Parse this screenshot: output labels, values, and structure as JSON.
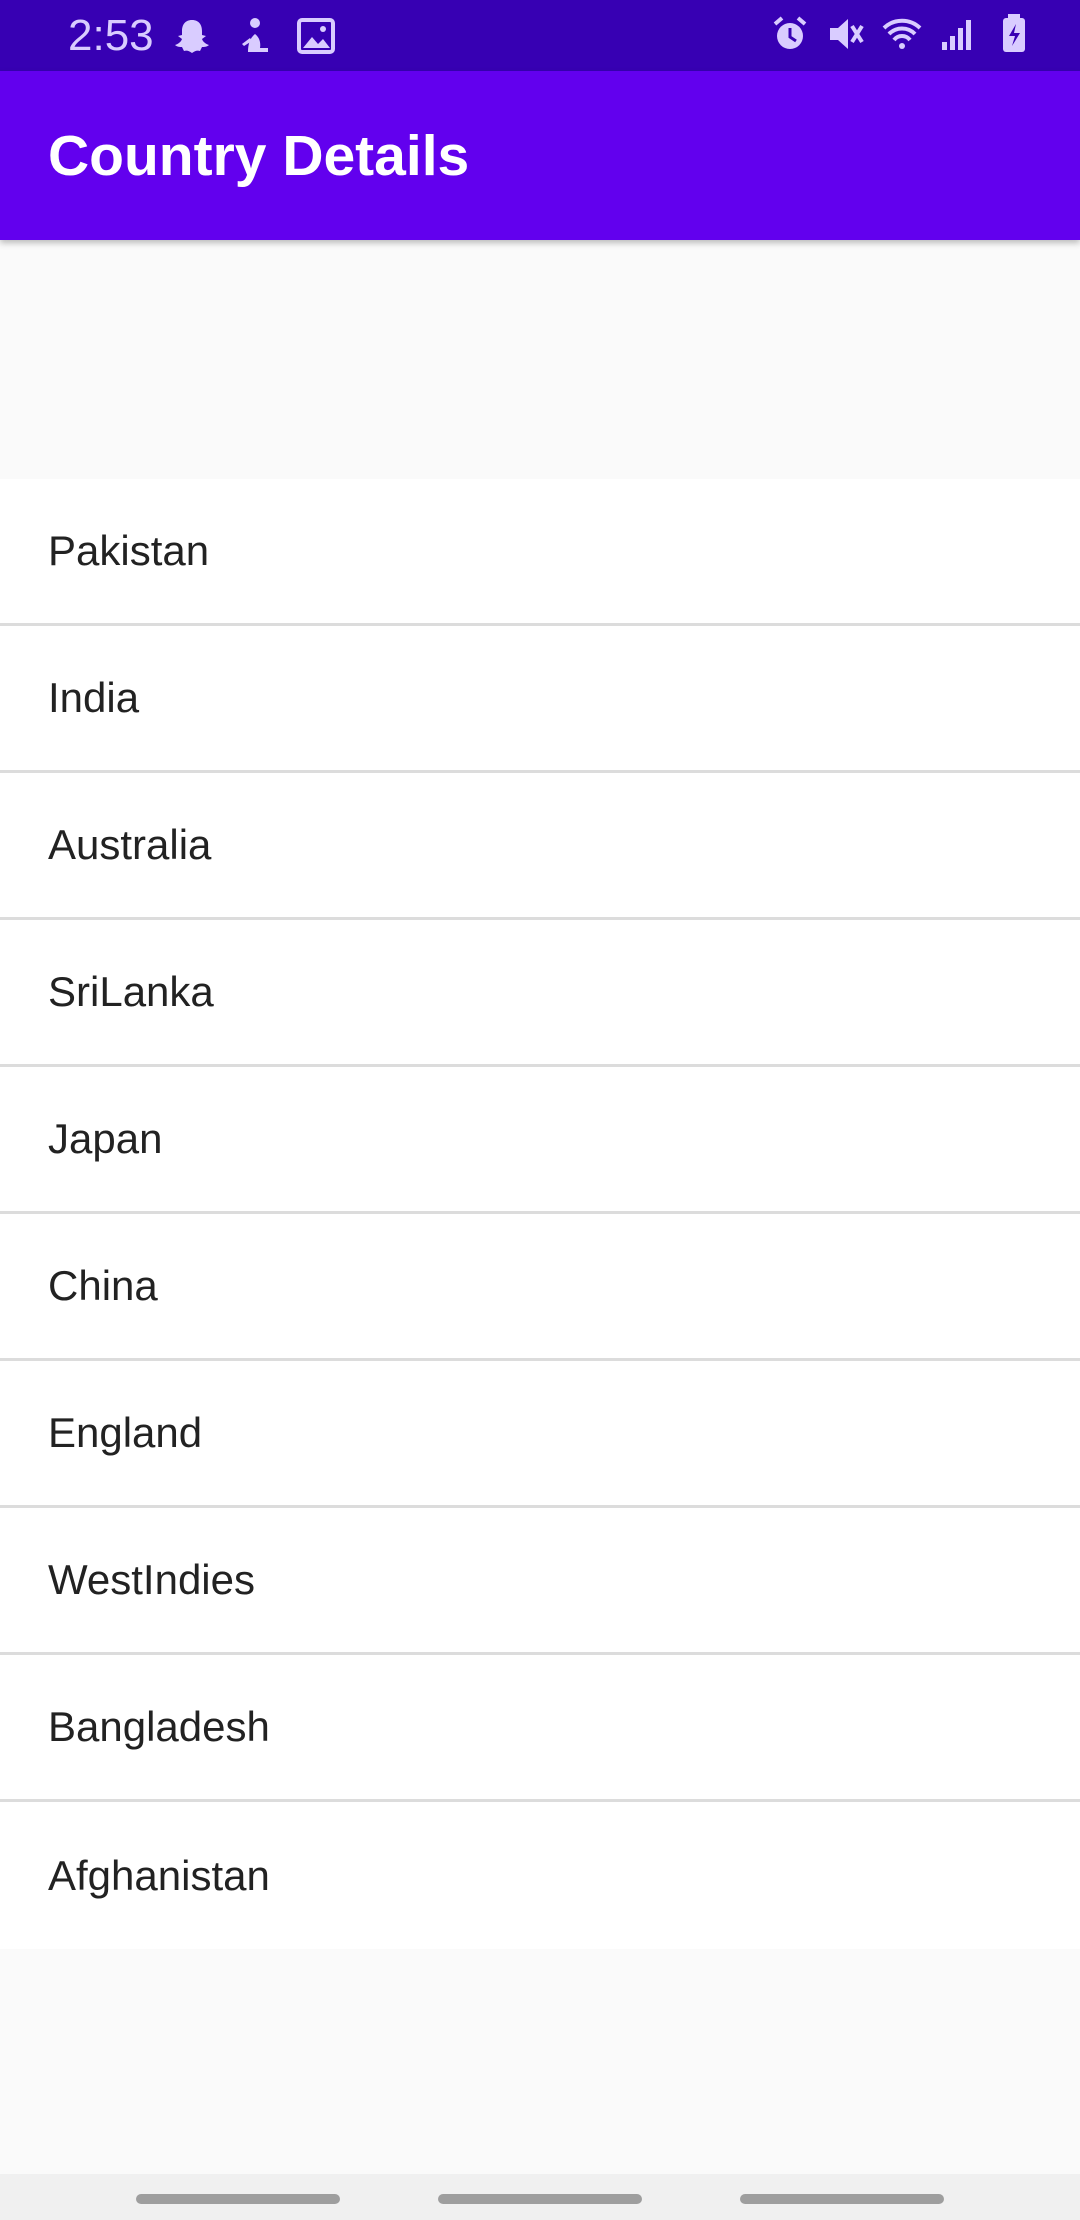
{
  "status_bar": {
    "time": "2:53",
    "left_icons": [
      "snapchat-icon",
      "notification-figure-icon",
      "image-icon"
    ],
    "right_icons": [
      "alarm-icon",
      "mute-icon",
      "wifi-icon",
      "signal-icon",
      "battery-charging-icon"
    ]
  },
  "app_bar": {
    "title": "Country Details",
    "color": "#6200ee"
  },
  "countries": [
    "Pakistan",
    "India",
    "Australia",
    "SriLanka",
    "Japan",
    "China",
    "England",
    "WestIndies",
    "Bangladesh",
    "Afghanistan"
  ],
  "nav_bar": {
    "items": [
      "recent-apps-button",
      "home-button",
      "back-button"
    ]
  }
}
